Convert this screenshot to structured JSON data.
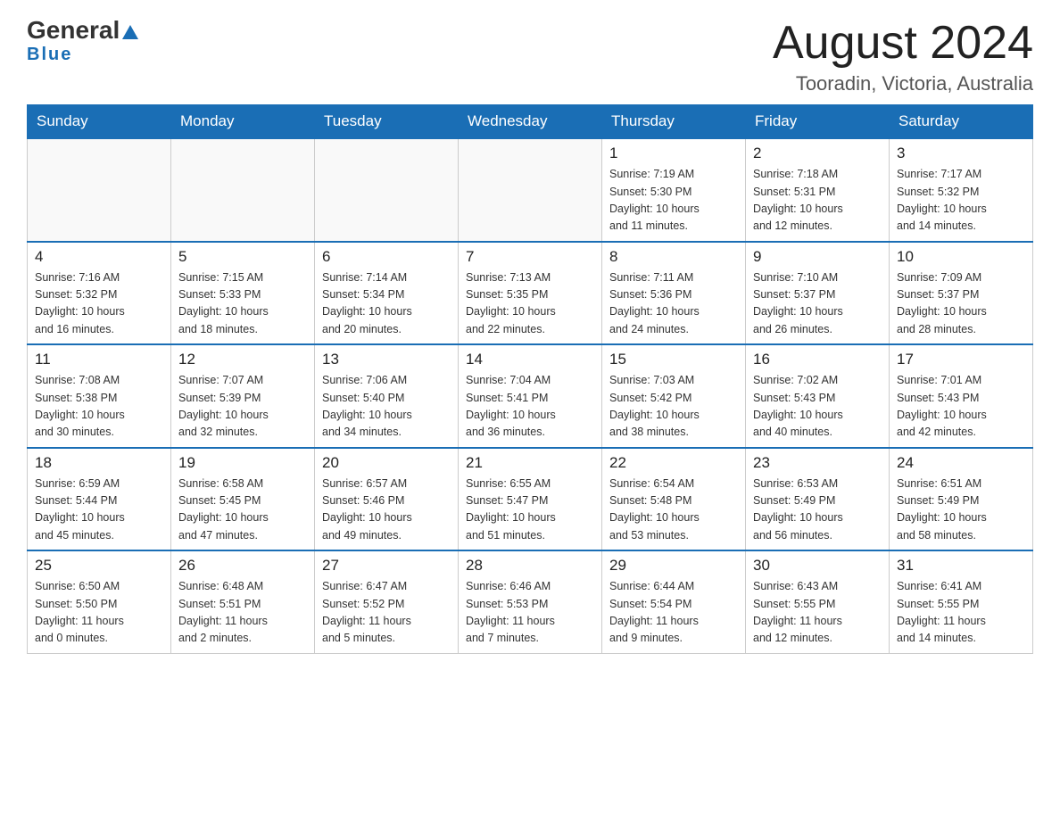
{
  "header": {
    "logo_general": "General",
    "logo_blue": "Blue",
    "month_title": "August 2024",
    "location": "Tooradin, Victoria, Australia"
  },
  "weekdays": [
    "Sunday",
    "Monday",
    "Tuesday",
    "Wednesday",
    "Thursday",
    "Friday",
    "Saturday"
  ],
  "weeks": [
    [
      {
        "day": "",
        "info": ""
      },
      {
        "day": "",
        "info": ""
      },
      {
        "day": "",
        "info": ""
      },
      {
        "day": "",
        "info": ""
      },
      {
        "day": "1",
        "info": "Sunrise: 7:19 AM\nSunset: 5:30 PM\nDaylight: 10 hours\nand 11 minutes."
      },
      {
        "day": "2",
        "info": "Sunrise: 7:18 AM\nSunset: 5:31 PM\nDaylight: 10 hours\nand 12 minutes."
      },
      {
        "day": "3",
        "info": "Sunrise: 7:17 AM\nSunset: 5:32 PM\nDaylight: 10 hours\nand 14 minutes."
      }
    ],
    [
      {
        "day": "4",
        "info": "Sunrise: 7:16 AM\nSunset: 5:32 PM\nDaylight: 10 hours\nand 16 minutes."
      },
      {
        "day": "5",
        "info": "Sunrise: 7:15 AM\nSunset: 5:33 PM\nDaylight: 10 hours\nand 18 minutes."
      },
      {
        "day": "6",
        "info": "Sunrise: 7:14 AM\nSunset: 5:34 PM\nDaylight: 10 hours\nand 20 minutes."
      },
      {
        "day": "7",
        "info": "Sunrise: 7:13 AM\nSunset: 5:35 PM\nDaylight: 10 hours\nand 22 minutes."
      },
      {
        "day": "8",
        "info": "Sunrise: 7:11 AM\nSunset: 5:36 PM\nDaylight: 10 hours\nand 24 minutes."
      },
      {
        "day": "9",
        "info": "Sunrise: 7:10 AM\nSunset: 5:37 PM\nDaylight: 10 hours\nand 26 minutes."
      },
      {
        "day": "10",
        "info": "Sunrise: 7:09 AM\nSunset: 5:37 PM\nDaylight: 10 hours\nand 28 minutes."
      }
    ],
    [
      {
        "day": "11",
        "info": "Sunrise: 7:08 AM\nSunset: 5:38 PM\nDaylight: 10 hours\nand 30 minutes."
      },
      {
        "day": "12",
        "info": "Sunrise: 7:07 AM\nSunset: 5:39 PM\nDaylight: 10 hours\nand 32 minutes."
      },
      {
        "day": "13",
        "info": "Sunrise: 7:06 AM\nSunset: 5:40 PM\nDaylight: 10 hours\nand 34 minutes."
      },
      {
        "day": "14",
        "info": "Sunrise: 7:04 AM\nSunset: 5:41 PM\nDaylight: 10 hours\nand 36 minutes."
      },
      {
        "day": "15",
        "info": "Sunrise: 7:03 AM\nSunset: 5:42 PM\nDaylight: 10 hours\nand 38 minutes."
      },
      {
        "day": "16",
        "info": "Sunrise: 7:02 AM\nSunset: 5:43 PM\nDaylight: 10 hours\nand 40 minutes."
      },
      {
        "day": "17",
        "info": "Sunrise: 7:01 AM\nSunset: 5:43 PM\nDaylight: 10 hours\nand 42 minutes."
      }
    ],
    [
      {
        "day": "18",
        "info": "Sunrise: 6:59 AM\nSunset: 5:44 PM\nDaylight: 10 hours\nand 45 minutes."
      },
      {
        "day": "19",
        "info": "Sunrise: 6:58 AM\nSunset: 5:45 PM\nDaylight: 10 hours\nand 47 minutes."
      },
      {
        "day": "20",
        "info": "Sunrise: 6:57 AM\nSunset: 5:46 PM\nDaylight: 10 hours\nand 49 minutes."
      },
      {
        "day": "21",
        "info": "Sunrise: 6:55 AM\nSunset: 5:47 PM\nDaylight: 10 hours\nand 51 minutes."
      },
      {
        "day": "22",
        "info": "Sunrise: 6:54 AM\nSunset: 5:48 PM\nDaylight: 10 hours\nand 53 minutes."
      },
      {
        "day": "23",
        "info": "Sunrise: 6:53 AM\nSunset: 5:49 PM\nDaylight: 10 hours\nand 56 minutes."
      },
      {
        "day": "24",
        "info": "Sunrise: 6:51 AM\nSunset: 5:49 PM\nDaylight: 10 hours\nand 58 minutes."
      }
    ],
    [
      {
        "day": "25",
        "info": "Sunrise: 6:50 AM\nSunset: 5:50 PM\nDaylight: 11 hours\nand 0 minutes."
      },
      {
        "day": "26",
        "info": "Sunrise: 6:48 AM\nSunset: 5:51 PM\nDaylight: 11 hours\nand 2 minutes."
      },
      {
        "day": "27",
        "info": "Sunrise: 6:47 AM\nSunset: 5:52 PM\nDaylight: 11 hours\nand 5 minutes."
      },
      {
        "day": "28",
        "info": "Sunrise: 6:46 AM\nSunset: 5:53 PM\nDaylight: 11 hours\nand 7 minutes."
      },
      {
        "day": "29",
        "info": "Sunrise: 6:44 AM\nSunset: 5:54 PM\nDaylight: 11 hours\nand 9 minutes."
      },
      {
        "day": "30",
        "info": "Sunrise: 6:43 AM\nSunset: 5:55 PM\nDaylight: 11 hours\nand 12 minutes."
      },
      {
        "day": "31",
        "info": "Sunrise: 6:41 AM\nSunset: 5:55 PM\nDaylight: 11 hours\nand 14 minutes."
      }
    ]
  ]
}
